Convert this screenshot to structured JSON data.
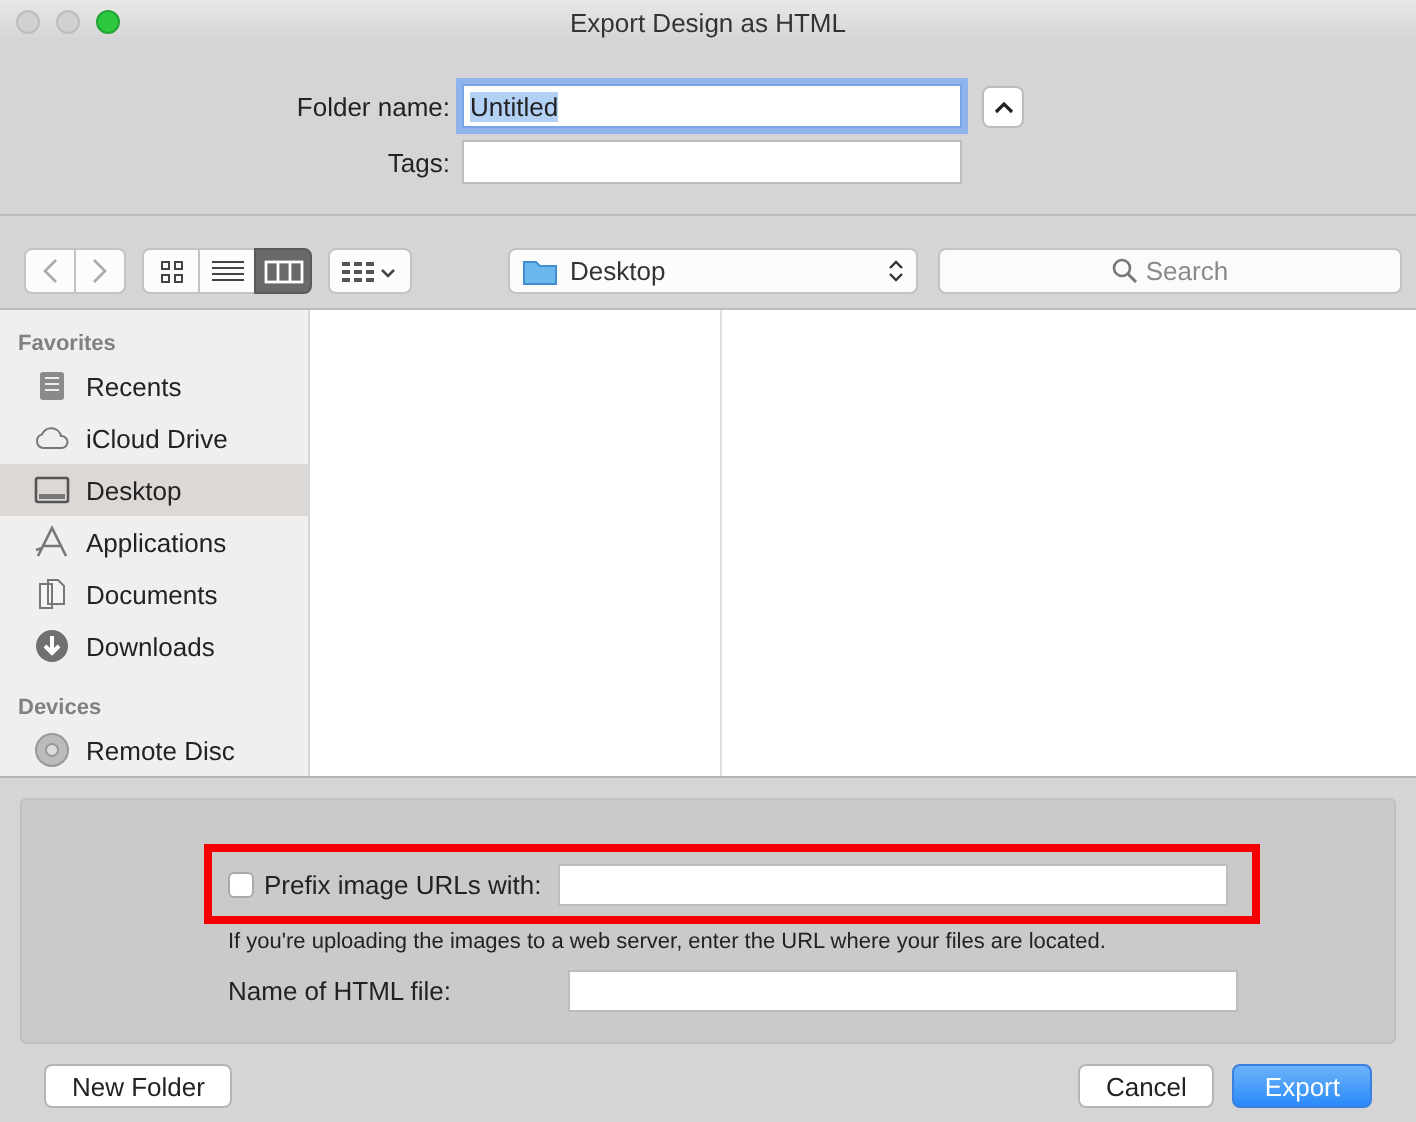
{
  "window": {
    "title": "Export Design as HTML"
  },
  "folder_name": {
    "label": "Folder name:",
    "value": "Untitled",
    "text_selected": true
  },
  "tags": {
    "label": "Tags:"
  },
  "view_modes": [
    {
      "kind": "icons",
      "selected": false
    },
    {
      "kind": "list",
      "selected": false
    },
    {
      "kind": "columns",
      "selected": true
    }
  ],
  "location": {
    "value": "Desktop"
  },
  "search": {
    "placeholder": "Search"
  },
  "sidebar": {
    "sections": [
      {
        "title": "Favorites",
        "items": [
          {
            "label": "Recents",
            "kind": "recents",
            "selected": false
          },
          {
            "label": "iCloud Drive",
            "kind": "cloud",
            "selected": false
          },
          {
            "label": "Desktop",
            "kind": "desktop",
            "selected": true
          },
          {
            "label": "Applications",
            "kind": "apps",
            "selected": false
          },
          {
            "label": "Documents",
            "kind": "documents",
            "selected": false
          },
          {
            "label": "Downloads",
            "kind": "downloads",
            "selected": false
          }
        ]
      },
      {
        "title": "Devices",
        "items": [
          {
            "label": "Remote Disc",
            "kind": "disc",
            "selected": false
          }
        ]
      }
    ]
  },
  "options": {
    "prefix": {
      "label": "Prefix image URLs with:",
      "checked": false,
      "highlighted": true
    },
    "hint": "If you're uploading the images to a web server, enter the URL where your files are located.",
    "file_name": {
      "label": "Name of HTML file:"
    }
  },
  "buttons": {
    "new_folder": "New Folder",
    "cancel": "Cancel",
    "export": "Export"
  }
}
